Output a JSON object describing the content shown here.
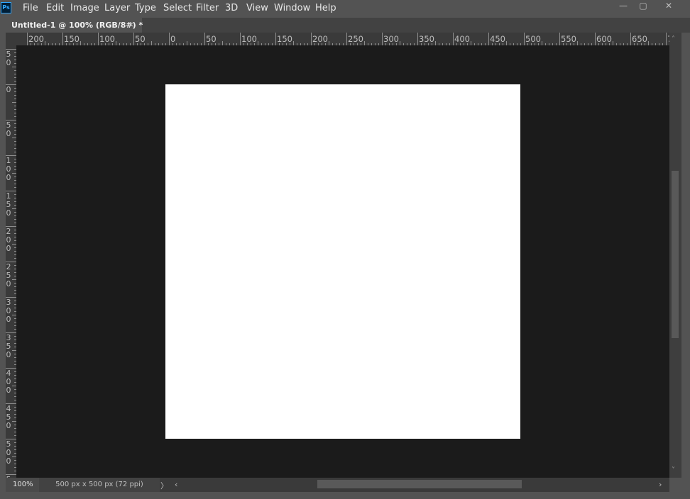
{
  "app": {
    "logo_text": "Ps"
  },
  "menu": [
    "File",
    "Edit",
    "Image",
    "Layer",
    "Type",
    "Select",
    "Filter",
    "3D",
    "View",
    "Window",
    "Help"
  ],
  "window_controls": {
    "minimize": "—",
    "maximize": "▢",
    "close": "✕"
  },
  "tab": {
    "title": "Untitled-1 @ 100% (RGB/8#) *",
    "close": "×"
  },
  "ruler": {
    "horizontal_labels": [
      "200",
      "150",
      "100",
      "50",
      "0",
      "50",
      "100",
      "150",
      "200",
      "250",
      "300",
      "350",
      "400",
      "450",
      "500",
      "550",
      "600",
      "650",
      "7"
    ],
    "vertical_labels": [
      [
        "5",
        "0"
      ],
      [
        "0"
      ],
      [
        "5",
        "0"
      ],
      [
        "1",
        "0",
        "0"
      ],
      [
        "1",
        "5",
        "0"
      ],
      [
        "2",
        "0",
        "0"
      ],
      [
        "2",
        "5",
        "0"
      ],
      [
        "3",
        "0",
        "0"
      ],
      [
        "3",
        "5",
        "0"
      ],
      [
        "4",
        "0",
        "0"
      ],
      [
        "4",
        "5",
        "0"
      ],
      [
        "5",
        "0",
        "0"
      ],
      [
        "5"
      ]
    ]
  },
  "status": {
    "zoom": "100%",
    "doc_info": "500 px x 500 px (72 ppi)",
    "expand_arrow": "〉",
    "scroll_left": "‹",
    "scroll_right": "›"
  },
  "scroll": {
    "up": "˄",
    "down": "˅"
  },
  "colors": {
    "chrome": "#535353",
    "pasteboard": "#1b1b1b",
    "ruler": "#3a3a3a",
    "document": "#ffffff",
    "accent": "#31a8ff"
  }
}
